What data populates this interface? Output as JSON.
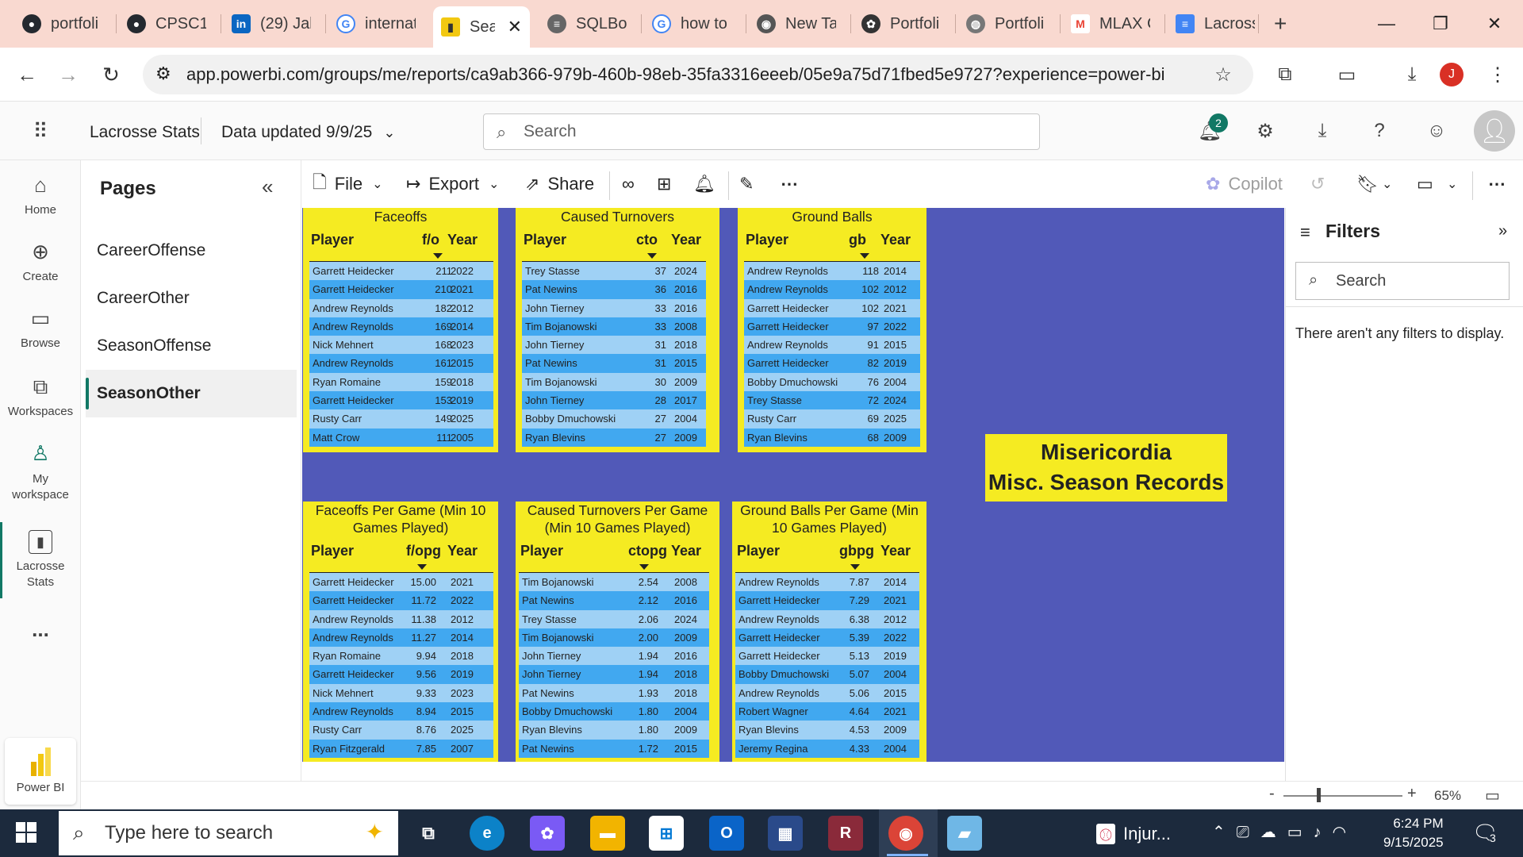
{
  "browser": {
    "tabs": [
      {
        "label": "portfoli",
        "icon": "github-icon"
      },
      {
        "label": "CPSC10",
        "icon": "github-icon"
      },
      {
        "label": "(29) Jak",
        "icon": "linkedin-icon"
      },
      {
        "label": "internat",
        "icon": "google-icon"
      },
      {
        "label": "Sea",
        "icon": "powerbi-icon",
        "active": true
      },
      {
        "label": "SQLBol",
        "icon": "sqlbolt-icon"
      },
      {
        "label": "how to",
        "icon": "google-icon"
      },
      {
        "label": "New Ta",
        "icon": "chrome-icon"
      },
      {
        "label": "Portfoli",
        "icon": "openai-icon"
      },
      {
        "label": "Portfoli",
        "icon": "globe-icon"
      },
      {
        "label": "MLAX C",
        "icon": "gmail-icon"
      },
      {
        "label": "Lacross",
        "icon": "docs-icon"
      }
    ],
    "new_tab": "+",
    "url": "app.powerbi.com/groups/me/reports/ca9ab366-979b-460b-98eb-35fa3316eeeb/05e9a75d71fbed5e9727?experience=power-bi",
    "profile_initial": "J"
  },
  "header": {
    "app_name": "Lacrosse Stats",
    "data_updated": "Data updated 9/9/25",
    "search_placeholder": "Search",
    "notification_count": "2"
  },
  "leftnav": {
    "items": [
      {
        "label": "Home",
        "icon": "home-icon"
      },
      {
        "label": "Create",
        "icon": "create-icon"
      },
      {
        "label": "Browse",
        "icon": "browse-icon"
      },
      {
        "label": "Workspaces",
        "icon": "workspaces-icon"
      },
      {
        "label": "My workspace",
        "icon": "my-workspace-icon"
      },
      {
        "label": "Lacrosse Stats",
        "icon": "report-icon",
        "active": true
      }
    ],
    "more": "...",
    "app_label": "Power BI"
  },
  "pages": {
    "title": "Pages",
    "items": [
      "CareerOffense",
      "CareerOther",
      "SeasonOffense",
      "SeasonOther"
    ],
    "active": "SeasonOther"
  },
  "toolbar": {
    "file": "File",
    "export": "Export",
    "share": "Share",
    "copilot": "Copilot"
  },
  "report": {
    "title_line1": "Misericordia",
    "title_line2": "Misc. Season Records",
    "colors": {
      "canvas": "#5159b8",
      "visual_bg": "#f5eb22",
      "row_light": "#9fd1f5",
      "row_dark": "#41a8f0"
    },
    "tables": [
      {
        "title": "Faceoffs",
        "headers": [
          "Player",
          "f/o",
          "Year"
        ],
        "rows": [
          [
            "Garrett Heidecker",
            "211",
            "2022"
          ],
          [
            "Garrett Heidecker",
            "210",
            "2021"
          ],
          [
            "Andrew Reynolds",
            "182",
            "2012"
          ],
          [
            "Andrew Reynolds",
            "169",
            "2014"
          ],
          [
            "Nick Mehnert",
            "168",
            "2023"
          ],
          [
            "Andrew Reynolds",
            "161",
            "2015"
          ],
          [
            "Ryan Romaine",
            "159",
            "2018"
          ],
          [
            "Garrett Heidecker",
            "153",
            "2019"
          ],
          [
            "Rusty Carr",
            "149",
            "2025"
          ],
          [
            "Matt Crow",
            "111",
            "2005"
          ]
        ]
      },
      {
        "title": "Caused Turnovers",
        "headers": [
          "Player",
          "cto",
          "Year"
        ],
        "rows": [
          [
            "Trey Stasse",
            "37",
            "2024"
          ],
          [
            "Pat Newins",
            "36",
            "2016"
          ],
          [
            "John Tierney",
            "33",
            "2016"
          ],
          [
            "Tim Bojanowski",
            "33",
            "2008"
          ],
          [
            "John Tierney",
            "31",
            "2018"
          ],
          [
            "Pat Newins",
            "31",
            "2015"
          ],
          [
            "Tim Bojanowski",
            "30",
            "2009"
          ],
          [
            "John Tierney",
            "28",
            "2017"
          ],
          [
            "Bobby Dmuchowski",
            "27",
            "2004"
          ],
          [
            "Ryan Blevins",
            "27",
            "2009"
          ]
        ]
      },
      {
        "title": "Ground Balls",
        "headers": [
          "Player",
          "gb",
          "Year"
        ],
        "rows": [
          [
            "Andrew Reynolds",
            "118",
            "2014"
          ],
          [
            "Andrew Reynolds",
            "102",
            "2012"
          ],
          [
            "Garrett Heidecker",
            "102",
            "2021"
          ],
          [
            "Garrett Heidecker",
            "97",
            "2022"
          ],
          [
            "Andrew Reynolds",
            "91",
            "2015"
          ],
          [
            "Garrett Heidecker",
            "82",
            "2019"
          ],
          [
            "Bobby Dmuchowski",
            "76",
            "2004"
          ],
          [
            "Trey Stasse",
            "72",
            "2024"
          ],
          [
            "Rusty Carr",
            "69",
            "2025"
          ],
          [
            "Ryan Blevins",
            "68",
            "2009"
          ]
        ]
      },
      {
        "title": "Faceoffs Per Game (Min 10 Games Played)",
        "headers": [
          "Player",
          "f/opg",
          "Year"
        ],
        "rows": [
          [
            "Garrett Heidecker",
            "15.00",
            "2021"
          ],
          [
            "Garrett Heidecker",
            "11.72",
            "2022"
          ],
          [
            "Andrew Reynolds",
            "11.38",
            "2012"
          ],
          [
            "Andrew Reynolds",
            "11.27",
            "2014"
          ],
          [
            "Ryan Romaine",
            "9.94",
            "2018"
          ],
          [
            "Garrett Heidecker",
            "9.56",
            "2019"
          ],
          [
            "Nick Mehnert",
            "9.33",
            "2023"
          ],
          [
            "Andrew Reynolds",
            "8.94",
            "2015"
          ],
          [
            "Rusty Carr",
            "8.76",
            "2025"
          ],
          [
            "Ryan Fitzgerald",
            "7.85",
            "2007"
          ]
        ]
      },
      {
        "title": "Caused Turnovers Per Game (Min 10 Games Played)",
        "headers": [
          "Player",
          "ctopg",
          "Year"
        ],
        "rows": [
          [
            "Tim Bojanowski",
            "2.54",
            "2008"
          ],
          [
            "Pat Newins",
            "2.12",
            "2016"
          ],
          [
            "Trey Stasse",
            "2.06",
            "2024"
          ],
          [
            "Tim Bojanowski",
            "2.00",
            "2009"
          ],
          [
            "John Tierney",
            "1.94",
            "2016"
          ],
          [
            "John Tierney",
            "1.94",
            "2018"
          ],
          [
            "Pat Newins",
            "1.93",
            "2018"
          ],
          [
            "Bobby Dmuchowski",
            "1.80",
            "2004"
          ],
          [
            "Ryan Blevins",
            "1.80",
            "2009"
          ],
          [
            "Pat Newins",
            "1.72",
            "2015"
          ]
        ]
      },
      {
        "title": "Ground Balls Per Game (Min 10 Games Played)",
        "headers": [
          "Player",
          "gbpg",
          "Year"
        ],
        "rows": [
          [
            "Andrew Reynolds",
            "7.87",
            "2014"
          ],
          [
            "Garrett Heidecker",
            "7.29",
            "2021"
          ],
          [
            "Andrew Reynolds",
            "6.38",
            "2012"
          ],
          [
            "Garrett Heidecker",
            "5.39",
            "2022"
          ],
          [
            "Garrett Heidecker",
            "5.13",
            "2019"
          ],
          [
            "Bobby Dmuchowski",
            "5.07",
            "2004"
          ],
          [
            "Andrew Reynolds",
            "5.06",
            "2015"
          ],
          [
            "Robert Wagner",
            "4.64",
            "2021"
          ],
          [
            "Ryan Blevins",
            "4.53",
            "2009"
          ],
          [
            "Jeremy Regina",
            "4.33",
            "2004"
          ]
        ]
      }
    ]
  },
  "filters": {
    "title": "Filters",
    "search_placeholder": "Search",
    "empty_message": "There aren't any filters to display."
  },
  "statusbar": {
    "zoom": "65%",
    "zoom_out": "-",
    "zoom_in": "+"
  },
  "taskbar": {
    "search_placeholder": "Type here to search",
    "news": "Injur...",
    "time": "6:24 PM",
    "date": "9/15/2025",
    "notifications": "3"
  }
}
